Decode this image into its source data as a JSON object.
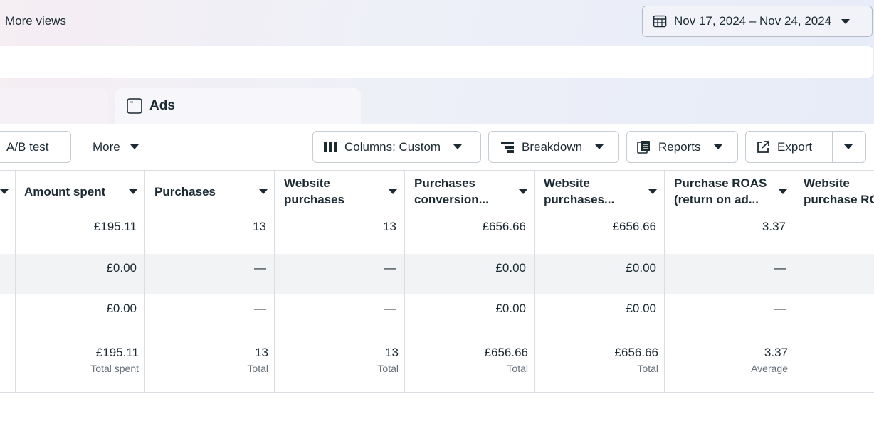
{
  "header": {
    "more_views": "More views",
    "date_range": "Nov 17, 2024 – Nov 24, 2024"
  },
  "tabs": {
    "ads": "Ads"
  },
  "toolbar": {
    "ab_test": "A/B test",
    "more": "More",
    "columns": "Columns: Custom",
    "breakdown": "Breakdown",
    "reports": "Reports",
    "export": "Export"
  },
  "table": {
    "columns": [
      {
        "line1": "Amount spent",
        "line2": ""
      },
      {
        "line1": "Purchases",
        "line2": ""
      },
      {
        "line1": "Website",
        "line2": "purchases"
      },
      {
        "line1": "Purchases",
        "line2": "conversion..."
      },
      {
        "line1": "Website",
        "line2": "purchases..."
      },
      {
        "line1": "Purchase ROAS",
        "line2": "(return on ad..."
      },
      {
        "line1": "Website",
        "line2": "purchase RO"
      }
    ],
    "rows": [
      [
        "£195.11",
        "13",
        "13",
        "£656.66",
        "£656.66",
        "3.37",
        ""
      ],
      [
        "£0.00",
        "—",
        "—",
        "£0.00",
        "£0.00",
        "—",
        ""
      ],
      [
        "£0.00",
        "—",
        "—",
        "£0.00",
        "£0.00",
        "—",
        ""
      ]
    ],
    "totals": [
      {
        "value": "£195.11",
        "label": "Total spent"
      },
      {
        "value": "13",
        "label": "Total"
      },
      {
        "value": "13",
        "label": "Total"
      },
      {
        "value": "£656.66",
        "label": "Total"
      },
      {
        "value": "£656.66",
        "label": "Total"
      },
      {
        "value": "3.37",
        "label": "Average"
      },
      {
        "value": "",
        "label": ""
      }
    ]
  }
}
